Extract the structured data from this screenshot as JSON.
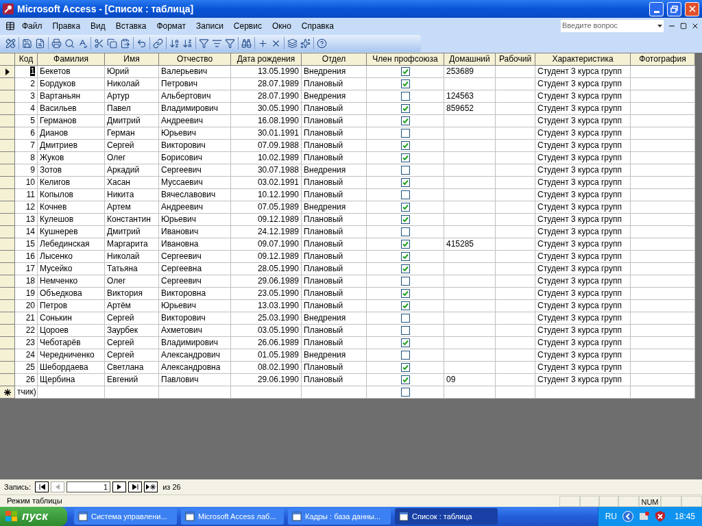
{
  "window": {
    "title": "Microsoft Access - [Список : таблица]"
  },
  "menu": [
    "Файл",
    "Правка",
    "Вид",
    "Вставка",
    "Формат",
    "Записи",
    "Сервис",
    "Окно",
    "Справка"
  ],
  "help_search": {
    "placeholder": "Введите вопрос"
  },
  "table": {
    "columns": [
      "Код",
      "Фамилия",
      "Имя",
      "Отчество",
      "Дата рождения",
      "Отдел",
      "Член профсоюза",
      "Домашний",
      "Рабочий",
      "Характеристика",
      "Фотография"
    ],
    "rows": [
      {
        "selected": true,
        "id": "1",
        "last_name": "Бекетов",
        "first_name": "Юрий",
        "patronymic": "Валерьевич",
        "birth_date": "13.05.1990",
        "department": "Внедрения",
        "union_member": true,
        "home_phone": "253689",
        "description": "Студент 3 курса групп"
      },
      {
        "selected": false,
        "id": "2",
        "last_name": "Бордуков",
        "first_name": "Николай",
        "patronymic": "Петрович",
        "birth_date": "28.07.1989",
        "department": "Плановый",
        "union_member": true,
        "description": "Студент 3 курса групп"
      },
      {
        "selected": false,
        "id": "3",
        "last_name": "Вартаньян",
        "first_name": "Артур",
        "patronymic": "Альбертович",
        "birth_date": "28.07.1990",
        "department": "Внедрения",
        "union_member": false,
        "home_phone": "124563",
        "description": "Студент 3 курса групп"
      },
      {
        "selected": false,
        "id": "4",
        "last_name": "Васильев",
        "first_name": "Павел",
        "patronymic": "Владимирович",
        "birth_date": "30.05.1990",
        "department": "Плановый",
        "union_member": true,
        "home_phone": "859652",
        "description": "Студент 3 курса групп"
      },
      {
        "selected": false,
        "id": "5",
        "last_name": "Германов",
        "first_name": "Дмитрий",
        "patronymic": "Андреевич",
        "birth_date": "16.08.1990",
        "department": "Плановый",
        "union_member": true,
        "description": "Студент 3 курса групп"
      },
      {
        "selected": false,
        "id": "6",
        "last_name": "Дианов",
        "first_name": "Герман",
        "patronymic": "Юрьевич",
        "birth_date": "30.01.1991",
        "department": "Плановый",
        "union_member": false,
        "description": "Студент 3 курса групп"
      },
      {
        "selected": false,
        "id": "7",
        "last_name": "Дмитриев",
        "first_name": "Сергей",
        "patronymic": "Викторович",
        "birth_date": "07.09.1988",
        "department": "Плановый",
        "union_member": true,
        "description": "Студент 3 курса групп"
      },
      {
        "selected": false,
        "id": "8",
        "last_name": "Жуков",
        "first_name": "Олег",
        "patronymic": "Борисович",
        "birth_date": "10.02.1989",
        "department": "Плановый",
        "union_member": true,
        "description": "Студент 3 курса групп"
      },
      {
        "selected": false,
        "id": "9",
        "last_name": "Зотов",
        "first_name": "Аркадий",
        "patronymic": "Сергеевич",
        "birth_date": "30.07.1988",
        "department": "Внедрения",
        "union_member": false,
        "description": "Студент 3 курса групп"
      },
      {
        "selected": false,
        "id": "10",
        "last_name": "Келигов",
        "first_name": "Хасан",
        "patronymic": "Муссаевич",
        "birth_date": "03.02.1991",
        "department": "Плановый",
        "union_member": true,
        "description": "Студент 3 курса групп"
      },
      {
        "selected": false,
        "id": "11",
        "last_name": "Копылов",
        "first_name": "Никита",
        "patronymic": "Вячеславович",
        "birth_date": "10.12.1990",
        "department": "Плановый",
        "union_member": false,
        "description": "Студент 3 курса групп"
      },
      {
        "selected": false,
        "id": "12",
        "last_name": "Кочнев",
        "first_name": "Артем",
        "patronymic": "Андреевич",
        "birth_date": "07.05.1989",
        "department": "Внедрения",
        "union_member": true,
        "description": "Студент 3 курса групп"
      },
      {
        "selected": false,
        "id": "13",
        "last_name": "Кулешов",
        "first_name": "Константин",
        "patronymic": "Юрьевич",
        "birth_date": "09.12.1989",
        "department": "Плановый",
        "union_member": true,
        "description": "Студент 3 курса групп"
      },
      {
        "selected": false,
        "id": "14",
        "last_name": "Кушнерев",
        "first_name": "Дмитрий",
        "patronymic": "Иванович",
        "birth_date": "24.12.1989",
        "department": "Плановый",
        "union_member": false,
        "description": "Студент 3 курса групп"
      },
      {
        "selected": false,
        "id": "15",
        "last_name": "Лебединская",
        "first_name": "Маргарита",
        "patronymic": "Ивановна",
        "birth_date": "09.07.1990",
        "department": "Плановый",
        "union_member": true,
        "home_phone": "415285",
        "description": "Студент 3 курса групп"
      },
      {
        "selected": false,
        "id": "16",
        "last_name": "Лысенко",
        "first_name": "Николай",
        "patronymic": "Сергеевич",
        "birth_date": "09.12.1989",
        "department": "Плановый",
        "union_member": true,
        "description": "Студент 3 курса групп"
      },
      {
        "selected": false,
        "id": "17",
        "last_name": "Мусейко",
        "first_name": "Татьяна",
        "patronymic": "Сергеевна",
        "birth_date": "28.05.1990",
        "department": "Плановый",
        "union_member": true,
        "description": "Студент 3 курса групп"
      },
      {
        "selected": false,
        "id": "18",
        "last_name": "Немченко",
        "first_name": "Олег",
        "patronymic": "Сергеевич",
        "birth_date": "29.06.1989",
        "department": "Плановый",
        "union_member": false,
        "description": "Студент 3 курса групп"
      },
      {
        "selected": false,
        "id": "19",
        "last_name": "Объедкова",
        "first_name": "Виктория",
        "patronymic": "Викторовна",
        "birth_date": "23.05.1990",
        "department": "Плановый",
        "union_member": true,
        "description": "Студент 3 курса групп"
      },
      {
        "selected": false,
        "id": "20",
        "last_name": "Петров",
        "first_name": "Артём",
        "patronymic": "Юрьевич",
        "birth_date": "13.03.1990",
        "department": "Плановый",
        "union_member": true,
        "description": "Студент 3 курса групп"
      },
      {
        "selected": false,
        "id": "21",
        "last_name": "Сонькин",
        "first_name": "Сергей",
        "patronymic": "Викторович",
        "birth_date": "25.03.1990",
        "department": "Внедрения",
        "union_member": false,
        "description": "Студент 3 курса групп"
      },
      {
        "selected": false,
        "id": "22",
        "last_name": "Цороев",
        "first_name": "Заурбек",
        "patronymic": "Ахметович",
        "birth_date": "03.05.1990",
        "department": "Плановый",
        "union_member": false,
        "description": "Студент 3 курса групп"
      },
      {
        "selected": false,
        "id": "23",
        "last_name": "Чеботарёв",
        "first_name": "Сергей",
        "patronymic": "Владимирович",
        "birth_date": "26.06.1989",
        "department": "Плановый",
        "union_member": true,
        "description": "Студент 3 курса групп"
      },
      {
        "selected": false,
        "id": "24",
        "last_name": "Чередниченко",
        "first_name": "Сергей",
        "patronymic": "Александрович",
        "birth_date": "01.05.1989",
        "department": "Внедрения",
        "union_member": false,
        "description": "Студент 3 курса групп"
      },
      {
        "selected": false,
        "id": "25",
        "last_name": "Шебордаева",
        "first_name": "Светлана",
        "patronymic": "Александровна",
        "birth_date": "08.02.1990",
        "department": "Плановый",
        "union_member": true,
        "description": "Студент 3 курса групп"
      },
      {
        "selected": false,
        "id": "26",
        "last_name": "Щербина",
        "first_name": "Евгений",
        "patronymic": "Павлович",
        "birth_date": "29.06.1990",
        "department": "Плановый",
        "union_member": true,
        "home_phone": "09",
        "description": "Студент 3 курса групп"
      }
    ],
    "new_row": {
      "id": "тчик)",
      "union_member": false
    }
  },
  "record_nav": {
    "label": "Запись:",
    "current": "1",
    "total": "из 26"
  },
  "status_bar": {
    "mode": "Режим таблицы",
    "num": "NUM"
  },
  "taskbar": {
    "start": "пуск",
    "tasks": [
      {
        "label": "Система управлени...",
        "selected": false
      },
      {
        "label": "Microsoft Access лаб...",
        "selected": false
      },
      {
        "label": "Кадры : база данны...",
        "selected": false
      },
      {
        "label": "Список : таблица",
        "selected": true
      }
    ],
    "language": "RU",
    "time": "18:45"
  }
}
